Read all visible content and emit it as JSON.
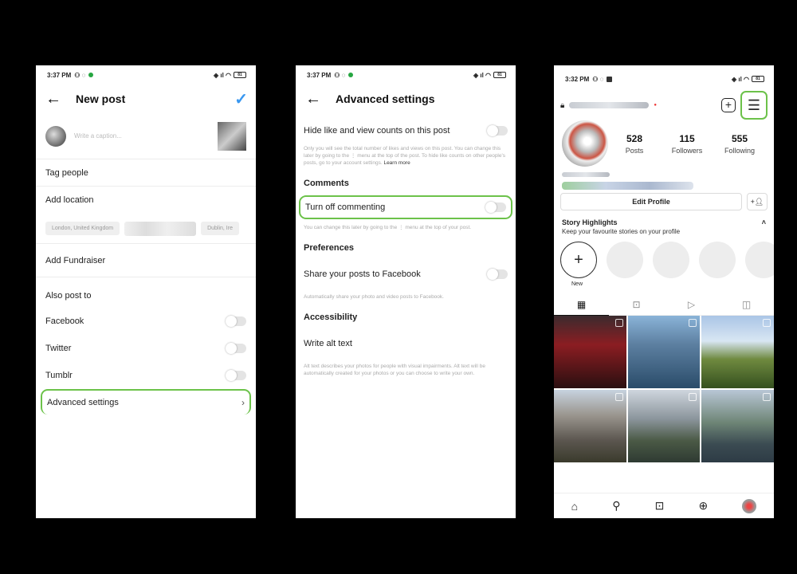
{
  "status": {
    "time1": "3:37 PM",
    "time2": "3:37 PM",
    "time3": "3:32 PM"
  },
  "new_post": {
    "title": "New post",
    "caption_placeholder": "Write a caption...",
    "tag_people": "Tag people",
    "add_location": "Add location",
    "location_chips": [
      "London, United Kingdom",
      "",
      "Dublin, Ire"
    ],
    "add_fundraiser": "Add Fundraiser",
    "also_post_to": "Also post to",
    "facebook": "Facebook",
    "twitter": "Twitter",
    "tumblr": "Tumblr",
    "advanced_settings": "Advanced settings"
  },
  "advanced": {
    "title": "Advanced settings",
    "hide_likes": "Hide like and view counts on this post",
    "hide_likes_desc": "Only you will see the total number of likes and views on this post. You can change this later by going to the ⋮ menu at the top of the post. To hide like counts on other people's posts, go to your account settings.",
    "learn_more": "Learn more",
    "comments_head": "Comments",
    "turn_off_commenting": "Turn off commenting",
    "commenting_desc": "You can change this later by going to the ⋮ menu at the top of your post.",
    "preferences_head": "Preferences",
    "share_facebook": "Share your posts to Facebook",
    "share_desc": "Automatically share your photo and video posts to Facebook.",
    "accessibility_head": "Accessibility",
    "alt_text": "Write alt text",
    "alt_desc": "Alt text describes your photos for people with visual impairments. Alt text will be automatically created for your photos or you can choose to write your own."
  },
  "profile": {
    "posts_count": "528",
    "posts_label": "Posts",
    "followers_count": "115",
    "followers_label": "Followers",
    "following_count": "555",
    "following_label": "Following",
    "edit_profile": "Edit Profile",
    "story_highlights": "Story Highlights",
    "highlights_sub": "Keep your favourite stories on your profile",
    "new_label": "New"
  },
  "accent_colors": {
    "highlight": "#6cc24a",
    "check": "#3897f0"
  }
}
